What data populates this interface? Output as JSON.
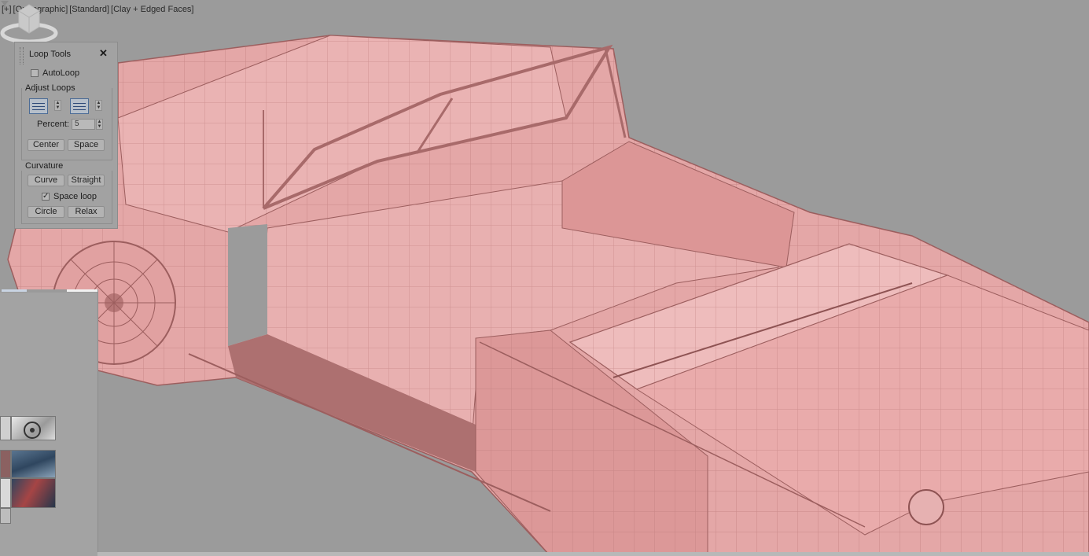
{
  "viewport": {
    "label_plus": "[+]",
    "label_projection": "[Orthographic]",
    "label_shading": "[Standard]",
    "label_style": "[Clay + Edged Faces]",
    "filter_icon": "funnel-icon",
    "viewcube_icon": "view-cube-icon"
  },
  "loop_tools": {
    "title": "Loop Tools",
    "close": "✕",
    "autoloop_label": "AutoLoop",
    "autoloop_checked": false,
    "adjust_loops": {
      "label": "Adjust Loops",
      "percent_label": "Percent:",
      "percent_value": "5",
      "center_label": "Center",
      "space_label": "Space"
    },
    "curvature": {
      "label": "Curvature",
      "curve_label": "Curve",
      "straight_label": "Straight",
      "space_loop_label": "Space loop",
      "space_loop_checked": true,
      "circle_label": "Circle",
      "relax_label": "Relax"
    }
  },
  "colors": {
    "viewport_bg": "#9b9b9b",
    "mesh_fill": "#e3a3a3",
    "mesh_edge": "#9c5e5e",
    "panel_bg": "#a2a2a2"
  }
}
